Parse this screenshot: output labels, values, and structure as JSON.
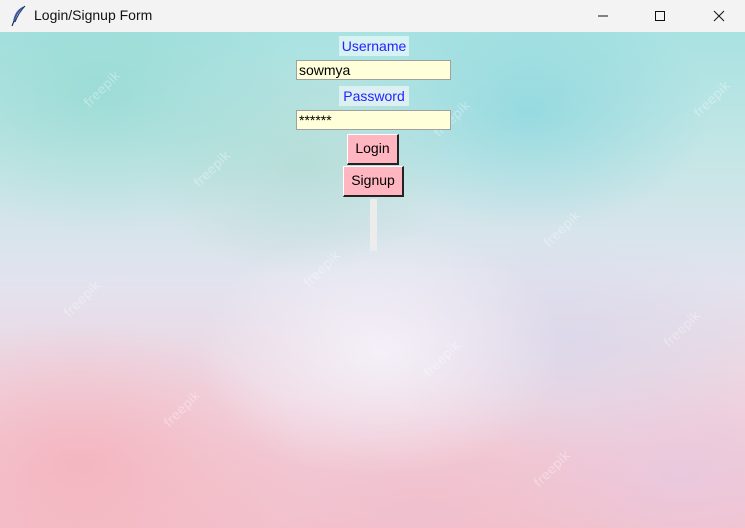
{
  "window": {
    "title": "Login/Signup Form",
    "icon": "feather-icon"
  },
  "form": {
    "username_label": "Username",
    "username_value": "sowmya",
    "password_label": "Password",
    "password_value": "******",
    "login_label": "Login",
    "signup_label": "Signup"
  },
  "background": {
    "watermark_text": "freepik"
  },
  "colors": {
    "label_text": "#2323ff",
    "entry_bg": "#ffffd9",
    "button_bg": "#ffb6c1"
  }
}
